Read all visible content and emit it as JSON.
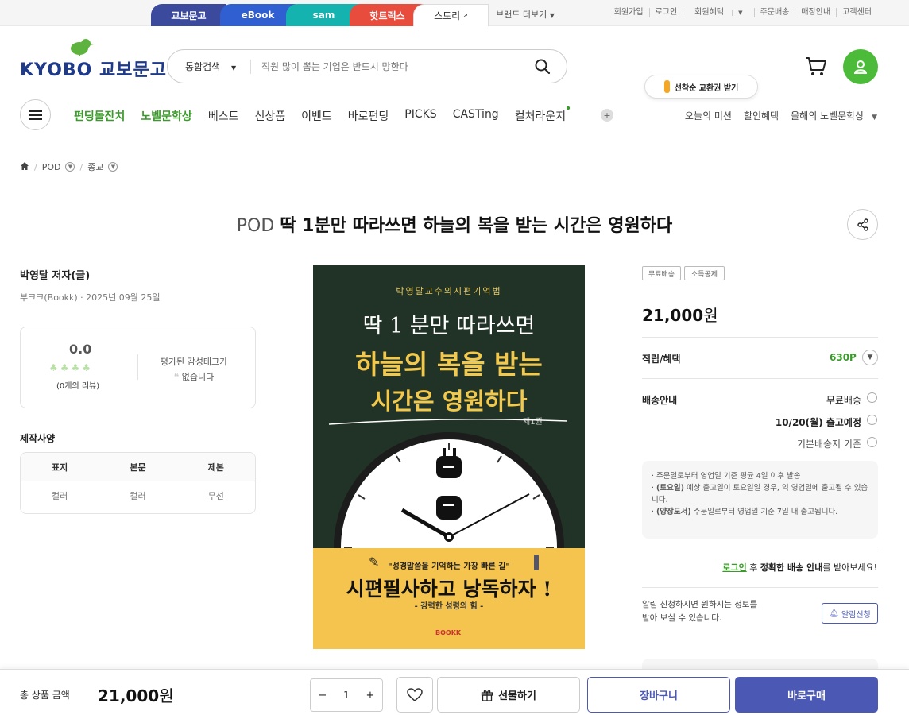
{
  "colors": {
    "brand_blue": "#4b59b5",
    "green": "#3a9a2a",
    "cover_bg": "#213326",
    "cover_yellow": "#f5c44e"
  },
  "service_tabs": [
    {
      "label": "교보문고",
      "color": "#3b4a9c"
    },
    {
      "label": "eBook",
      "color": "#2f5fd1"
    },
    {
      "label": "sam",
      "color": "#15b3b0"
    },
    {
      "label": "핫트랙스",
      "color": "#e84c3d"
    },
    {
      "label": "스토리",
      "color": "#ffffff"
    }
  ],
  "brand_more": "브랜드 더보기",
  "top_links": [
    "회원가입",
    "로그인",
    "회원혜택",
    "주문배송",
    "매장안내",
    "고객센터"
  ],
  "header": {
    "logo": "KYOBO 교보문고",
    "search_category": "통합검색",
    "search_placeholder": "직원 많이 뽑는 기업은 반드시 망한다",
    "mission_label": "선착순 교환권 받기"
  },
  "nav": {
    "items": [
      {
        "label": "펀딩돌잔치",
        "green": true
      },
      {
        "label": "노벨문학상",
        "green": true
      },
      {
        "label": "베스트",
        "green": false
      },
      {
        "label": "신상품",
        "green": false
      },
      {
        "label": "이벤트",
        "green": false
      },
      {
        "label": "바로펀딩",
        "green": false
      },
      {
        "label": "PICKS",
        "green": false
      },
      {
        "label": "CASTing",
        "green": false
      },
      {
        "label": "컬처라운지",
        "green": false
      }
    ],
    "right": [
      "오늘의 미션",
      "할인혜택",
      "올해의 노벨문학상"
    ]
  },
  "breadcrumb": [
    "POD",
    "종교"
  ],
  "product": {
    "prefix": "POD",
    "title": "딱 1분만 따라쓰면 하늘의 복을 받는 시간은 영원하다",
    "author": "박영달 저자(글)",
    "publisher": "부크크(Bookk) · 2025년 09월 25일",
    "rating": "0.0",
    "review_count": "(0개의 리뷰)",
    "emotion_line1": "평가된 감성태그가",
    "emotion_line2": "없습니다",
    "spec_title": "제작사양",
    "spec_headers": [
      "표지",
      "본문",
      "제본"
    ],
    "spec_values": [
      "컬러",
      "컬러",
      "무선"
    ]
  },
  "cover": {
    "series": "박영달교수의시편기억법",
    "line1": "딱 1 분만  따라쓰면",
    "line2": "하늘의 복을 받는",
    "line3": "시간은 영원하다",
    "volume": "제1권",
    "quote": "\"성경말씀을 기억하는 가장 빠른 길\"",
    "slogan": "시편필사하고 낭독하자 !",
    "subslogan": "- 강력한 성령의 힘 -",
    "publisher_mark": "BOOKK"
  },
  "purchase": {
    "tags": [
      "무료배송",
      "소득공제"
    ],
    "price": "21,000",
    "won": "원",
    "points_label": "적립/혜택",
    "points_value": "630P",
    "delivery_label": "배송안내",
    "delivery_free": "무료배송",
    "delivery_date": "10/20(월) 출고예정",
    "delivery_base": "기본배송지 기준",
    "notice": [
      {
        "bold": "",
        "text": "주문일로부터 영업일 기준 평균 4일 이후 발송"
      },
      {
        "bold": "(토요일)",
        "text": " 예상 출고일이 토요일일 경우, 익 영업일에 출고될 수 있습니다."
      },
      {
        "bold": "(양장도서)",
        "text": " 주문일로부터 영업일 기준 7일 내 출고됩니다."
      }
    ],
    "login_link": "로그인",
    "login_after": " 후 ",
    "login_bold": "정확한 배송 안내",
    "login_tail": "를 받아보세요!",
    "alarm_line1": "알림 신청하시면 원하시는 정보를",
    "alarm_line2": "받아 보실 수 있습니다.",
    "alarm_button": "알림신청"
  },
  "bottom_bar": {
    "total_label": "총 상품 금액",
    "total_value": "21,000",
    "won": "원",
    "quantity": "1",
    "gift": "선물하기",
    "cart": "장바구니",
    "buy": "바로구매"
  }
}
